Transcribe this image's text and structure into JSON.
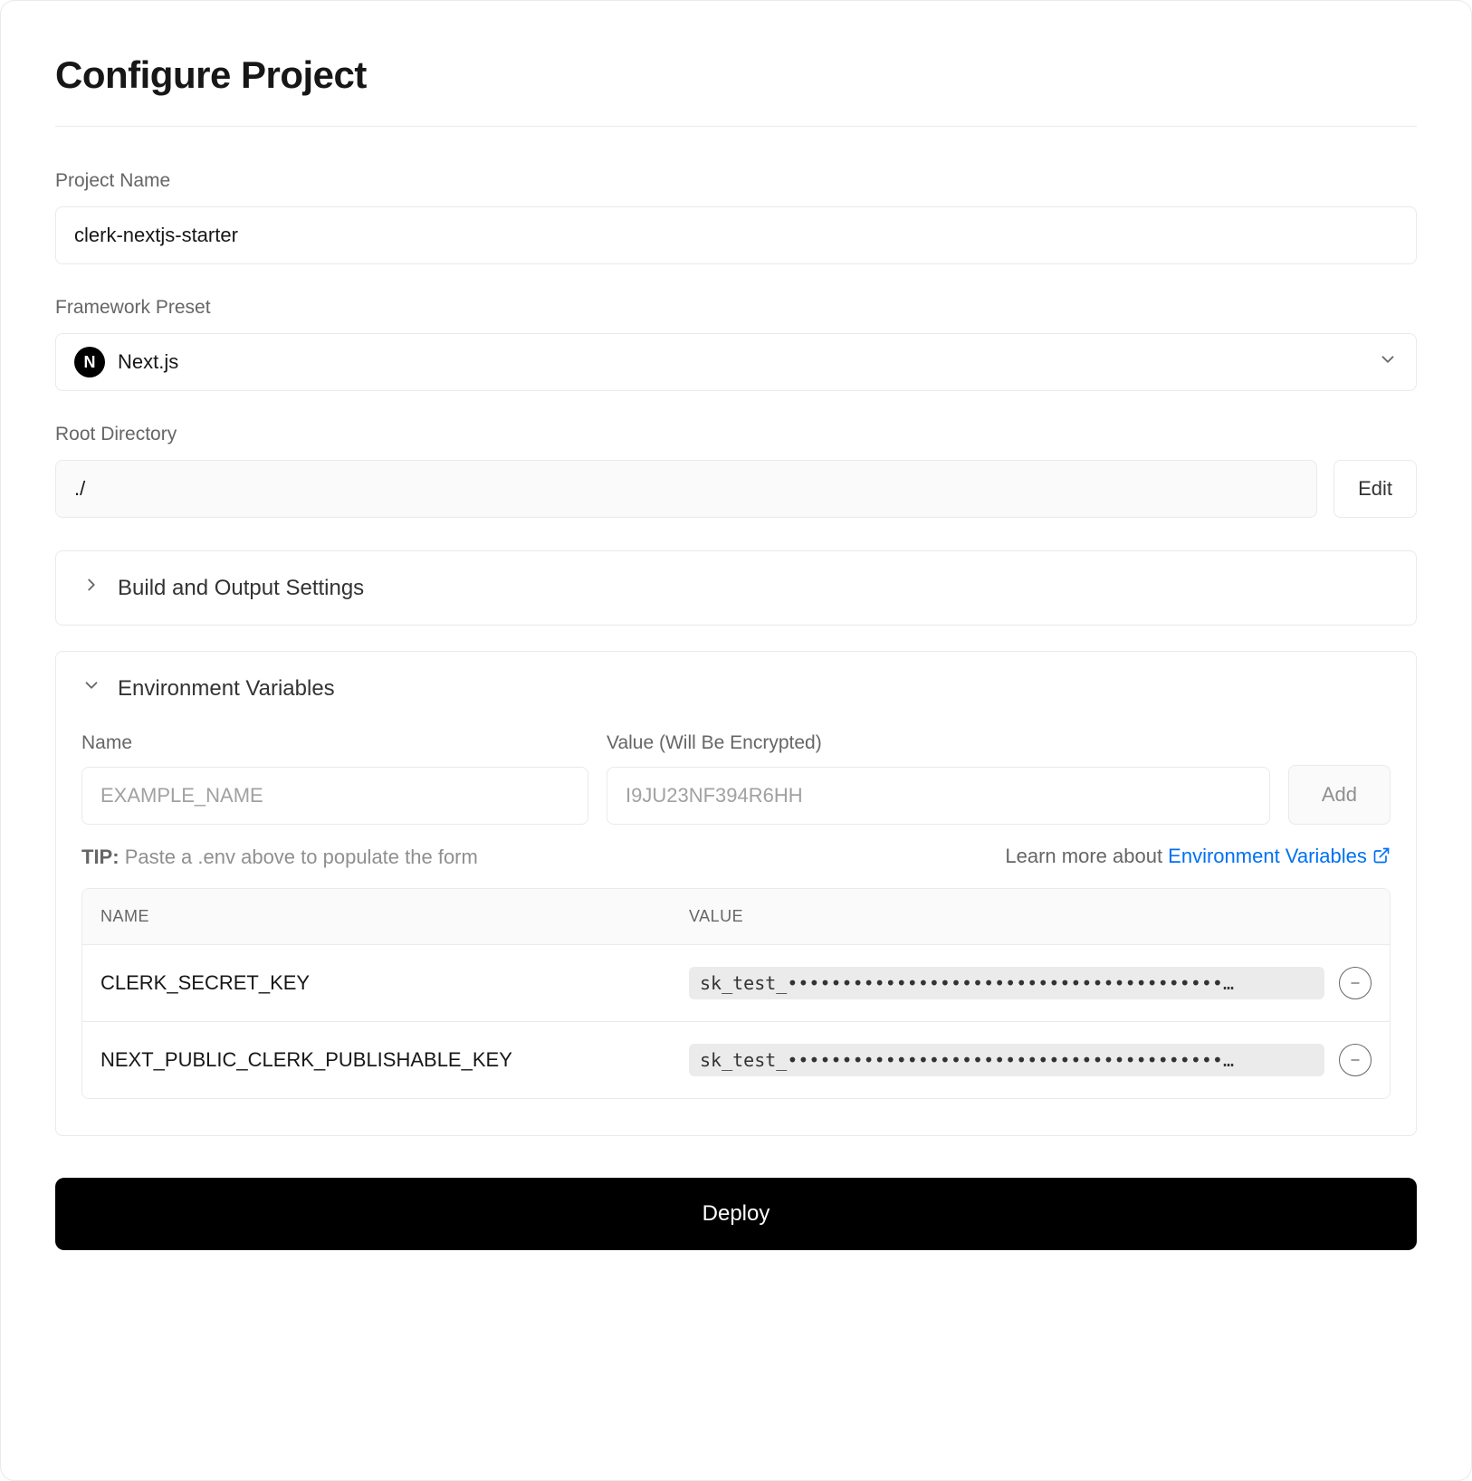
{
  "title": "Configure Project",
  "projectName": {
    "label": "Project Name",
    "value": "clerk-nextjs-starter"
  },
  "frameworkPreset": {
    "label": "Framework Preset",
    "icon": "nextjs-icon",
    "value": "Next.js"
  },
  "rootDirectory": {
    "label": "Root Directory",
    "value": "./",
    "editLabel": "Edit"
  },
  "buildSection": {
    "title": "Build and Output Settings",
    "expanded": false
  },
  "envSection": {
    "title": "Environment Variables",
    "expanded": true,
    "nameLabel": "Name",
    "valueLabel": "Value (Will Be Encrypted)",
    "namePlaceholder": "EXAMPLE_NAME",
    "valuePlaceholder": "I9JU23NF394R6HH",
    "addLabel": "Add",
    "tipLabel": "TIP:",
    "tipText": "Paste a .env above to populate the form",
    "learnText": "Learn more about ",
    "learnLink": "Environment Variables",
    "table": {
      "headerName": "NAME",
      "headerValue": "VALUE",
      "rows": [
        {
          "name": "CLERK_SECRET_KEY",
          "value": "sk_test_••••••••••••••••••••••••••••••••••••••••…"
        },
        {
          "name": "NEXT_PUBLIC_CLERK_PUBLISHABLE_KEY",
          "value": "sk_test_••••••••••••••••••••••••••••••••••••••••…"
        }
      ]
    }
  },
  "deployLabel": "Deploy"
}
